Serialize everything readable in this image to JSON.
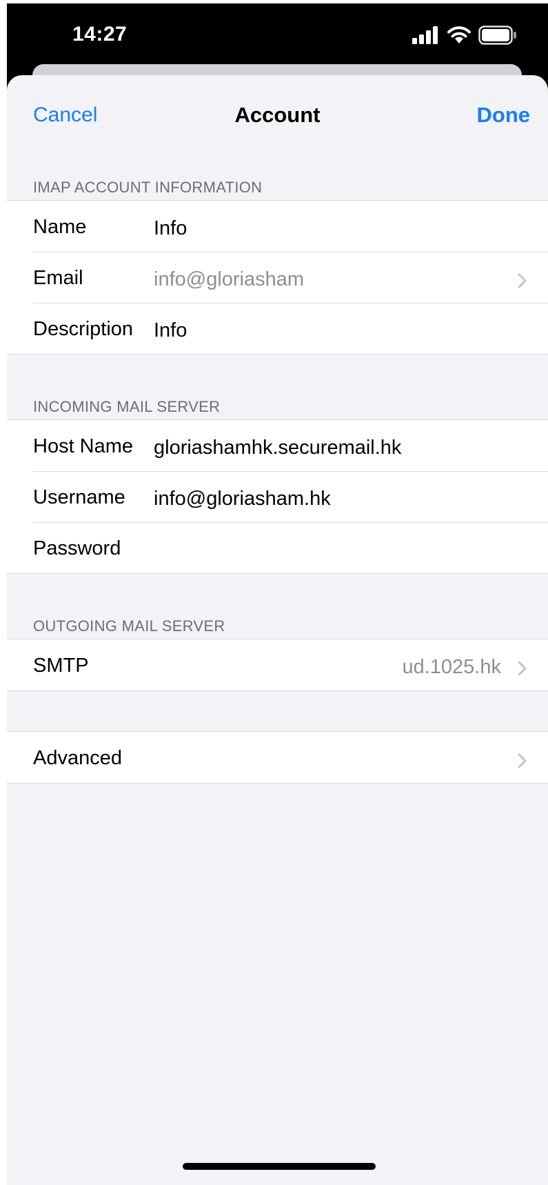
{
  "status_bar": {
    "time": "14:27",
    "signal_icon": "signal-icon",
    "wifi_icon": "wifi-icon",
    "battery_icon": "battery-icon"
  },
  "nav": {
    "cancel_label": "Cancel",
    "title": "Account",
    "done_label": "Done"
  },
  "imap_section": {
    "header": "IMAP ACCOUNT INFORMATION",
    "rows": [
      {
        "label": "Name",
        "value": "Info"
      },
      {
        "label": "Email",
        "value": "info@gloriasham"
      },
      {
        "label": "Description",
        "value": "Info"
      }
    ]
  },
  "incoming_section": {
    "header": "INCOMING MAIL SERVER",
    "rows": [
      {
        "label": "Host Name",
        "value": "gloriashamhk.securemail.hk"
      },
      {
        "label": "Username",
        "value": "info@gloriasham.hk"
      },
      {
        "label": "Password",
        "value": ""
      }
    ]
  },
  "outgoing_section": {
    "header": "OUTGOING MAIL SERVER",
    "rows": [
      {
        "label": "SMTP",
        "value": "ud.1025.hk"
      }
    ]
  },
  "advanced": {
    "label": "Advanced"
  },
  "colors": {
    "accent": "#1a7cf5",
    "background": "#f2f2f7",
    "secondary_text": "#8e8e93"
  }
}
